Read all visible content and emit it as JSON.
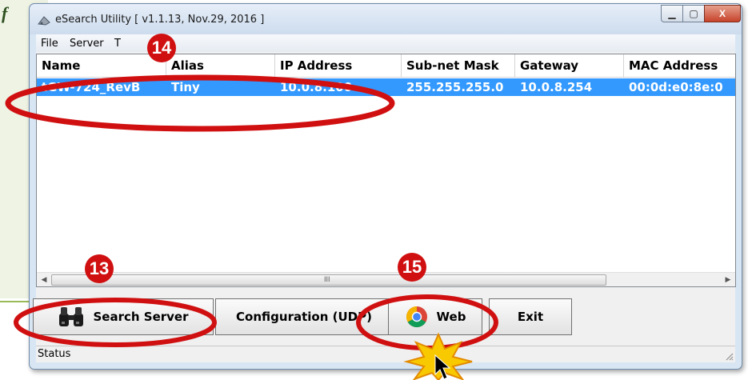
{
  "doc": {
    "glyph": "f"
  },
  "window": {
    "title": "eSearch Utility [ v1.1.13, Nov.29, 2016 ]",
    "controls": {
      "minimize": "▁",
      "maximize": "▢",
      "close": "X"
    }
  },
  "menu": {
    "items": [
      "File",
      "Server",
      "T"
    ]
  },
  "table": {
    "columns": [
      "Name",
      "Alias",
      "IP Address",
      "Sub-net Mask",
      "Gateway",
      "MAC Address"
    ],
    "rows": [
      [
        "tGW-724_RevB",
        "Tiny",
        "10.0.8.100",
        "255.255.255.0",
        "10.0.8.254",
        "00:0d:e0:8e:0"
      ]
    ],
    "scroll_grip": "III"
  },
  "buttons": {
    "search": "Search Server",
    "config": "Configuration (UDP)",
    "web": "Web",
    "exit": "Exit"
  },
  "status": "Status",
  "annotations": {
    "badge13": "13",
    "badge14": "14",
    "badge15": "15"
  },
  "colors": {
    "highlight": "#3399ff",
    "annotation_red": "#d01010"
  },
  "icons": [
    "app-icon",
    "binoculars-icon",
    "chrome-icon",
    "cursor-icon",
    "resize-grip-icon"
  ]
}
